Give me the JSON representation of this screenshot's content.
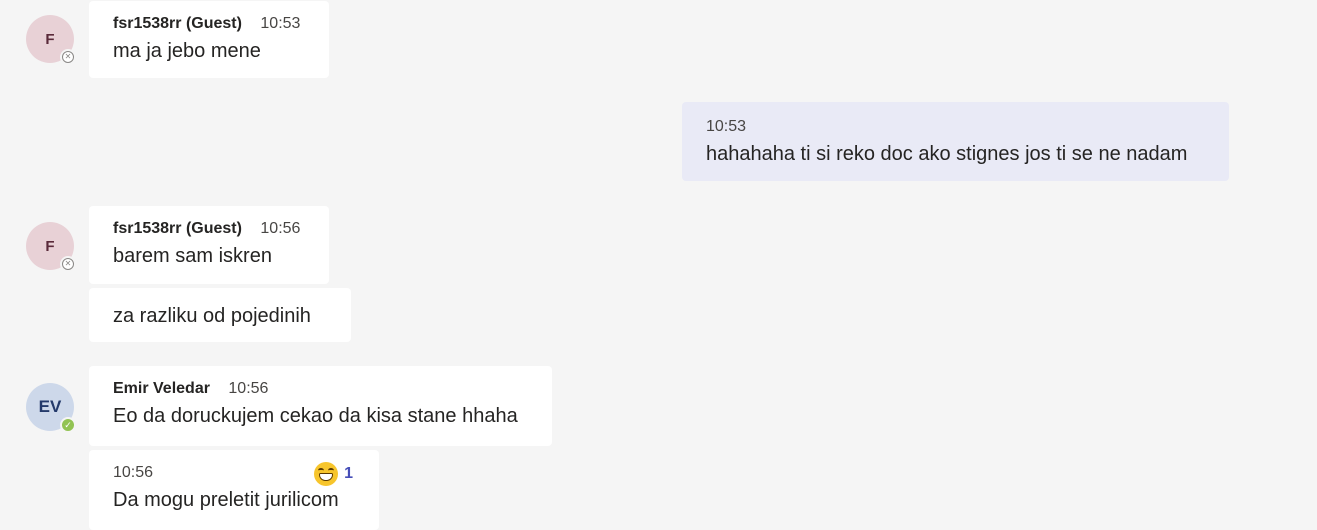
{
  "messages": [
    {
      "author": "fsr1538rr (Guest)",
      "avatar_initials": "F",
      "presence": "offline",
      "time": "10:53",
      "text": "ma ja jebo mene"
    },
    {
      "self": true,
      "time": "10:53",
      "text": "hahahaha ti si reko doc ako stignes jos ti se ne nadam"
    },
    {
      "author": "fsr1538rr (Guest)",
      "avatar_initials": "F",
      "presence": "offline",
      "time": "10:56",
      "text": "barem sam iskren"
    },
    {
      "continuation": true,
      "text": "za razliku od pojedinih"
    },
    {
      "author": "Emir Veledar",
      "avatar_initials": "EV",
      "presence": "available",
      "time": "10:56",
      "text": "Eo da doruckujem cekao da kisa stane hhaha"
    },
    {
      "continuation": true,
      "time": "10:56",
      "text": "Da mogu preletit jurilicom",
      "reaction": {
        "icon": "grinning-face-emoji-icon",
        "count": "1"
      }
    }
  ],
  "colors": {
    "background": "#f5f5f5",
    "bubble": "#ffffff",
    "self_bubble": "#e9eaf6",
    "available": "#92c353",
    "reaction_count": "#464eb8"
  }
}
